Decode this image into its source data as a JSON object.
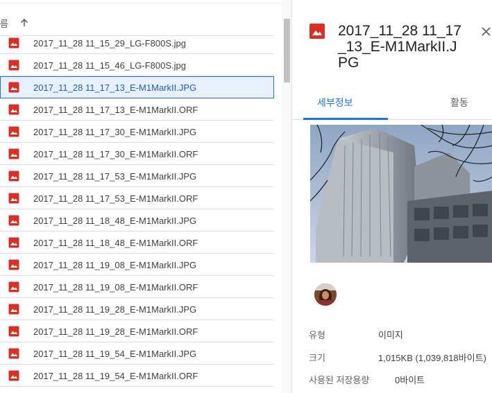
{
  "list": {
    "column_name": "이름",
    "column_name_visible": "름",
    "sort_direction": "ascending",
    "files": [
      {
        "name": "2017_11_28 11_15_29_LG-F800S.jpg",
        "selected": false
      },
      {
        "name": "2017_11_28 11_15_46_LG-F800S.jpg",
        "selected": false
      },
      {
        "name": "2017_11_28 11_17_13_E-M1MarkII.JPG",
        "selected": true
      },
      {
        "name": "2017_11_28 11_17_13_E-M1MarkII.ORF",
        "selected": false
      },
      {
        "name": "2017_11_28 11_17_30_E-M1MarkII.JPG",
        "selected": false
      },
      {
        "name": "2017_11_28 11_17_30_E-M1MarkII.ORF",
        "selected": false
      },
      {
        "name": "2017_11_28 11_17_53_E-M1MarkII.JPG",
        "selected": false
      },
      {
        "name": "2017_11_28 11_17_53_E-M1MarkII.ORF",
        "selected": false
      },
      {
        "name": "2017_11_28 11_18_48_E-M1MarkII.JPG",
        "selected": false
      },
      {
        "name": "2017_11_28 11_18_48_E-M1MarkII.ORF",
        "selected": false
      },
      {
        "name": "2017_11_28 11_19_08_E-M1MarkII.JPG",
        "selected": false
      },
      {
        "name": "2017_11_28 11_19_08_E-M1MarkII.ORF",
        "selected": false
      },
      {
        "name": "2017_11_28 11_19_28_E-M1MarkII.JPG",
        "selected": false
      },
      {
        "name": "2017_11_28 11_19_28_E-M1MarkII.ORF",
        "selected": false
      },
      {
        "name": "2017_11_28 11_19_54_E-M1MarkII.JPG",
        "selected": false
      },
      {
        "name": "2017_11_28 11_19_54_E-M1MarkII.ORF",
        "selected": false
      }
    ]
  },
  "details": {
    "title": "2017_11_28 11_17_13_E-M1MarkII.JPG",
    "tabs": {
      "details": "세부정보",
      "activity": "활동"
    },
    "active_tab": "details",
    "properties": {
      "type_label": "유형",
      "type_value": "이미지",
      "size_label": "크기",
      "size_value": "1,015KB (1,039,818바이트)",
      "storage_label": "사용된 저장용량",
      "storage_value": "0바이트"
    }
  },
  "icons": {
    "file_icon": "image-file-icon",
    "sort_icon": "arrow-up-icon",
    "close_icon": "close-icon"
  },
  "colors": {
    "accent": "#1a73e8",
    "image_icon": "#d93025",
    "selected_bg": "#e8f0fe"
  }
}
